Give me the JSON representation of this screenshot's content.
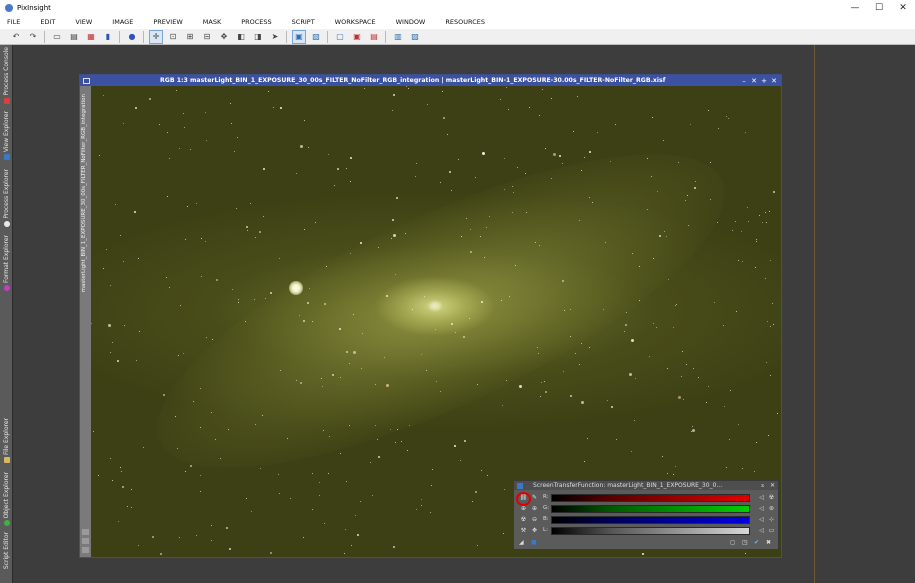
{
  "app": {
    "title": "PixInsight"
  },
  "window_controls": {
    "minimize": "—",
    "maximize": "☐",
    "close": "✕"
  },
  "menu": [
    "FILE",
    "EDIT",
    "VIEW",
    "IMAGE",
    "PREVIEW",
    "MASK",
    "PROCESS",
    "SCRIPT",
    "WORKSPACE",
    "WINDOW",
    "RESOURCES"
  ],
  "left_dock": {
    "tabs": [
      {
        "label": "Process Console",
        "icon_color": "#d84040"
      },
      {
        "label": "View Explorer",
        "icon_color": "#3c78c8"
      },
      {
        "label": "Process Explorer",
        "icon_color": "#e8e8e8"
      },
      {
        "label": "Format Explorer",
        "icon_color": "#c040c0"
      },
      {
        "label": "File Explorer",
        "icon_color": "#d8b860"
      },
      {
        "label": "Object Explorer",
        "icon_color": "#40b040"
      },
      {
        "label": "Script Editor",
        "icon_color": "#e8e8e8"
      }
    ]
  },
  "image_window": {
    "title": "RGB 1:3 masterLight_BIN_1_EXPOSURE_30_00s_FILTER_NoFilter_RGB_integration | masterLight_BIN-1_EXPOSURE-30.00s_FILTER-NoFilter_RGB.xisf",
    "side_label": "masterLight_BIN_1_EXPOSURE_30_00s_FILTER_NoFilter_RGB_integration",
    "controls": [
      "–",
      "✕",
      "+",
      "✕"
    ]
  },
  "stf_panel": {
    "title": "ScreenTransferFunction: masterLight_BIN_1_EXPOSURE_30_0...",
    "channels": [
      {
        "label": "R:",
        "color": "#e00000"
      },
      {
        "label": "G:",
        "color": "#00d000"
      },
      {
        "label": "B:",
        "color": "#0000e0"
      },
      {
        "label": "L:",
        "color": "#d8d8d8"
      }
    ],
    "highlighted_tool": "link-rgb-channels"
  }
}
